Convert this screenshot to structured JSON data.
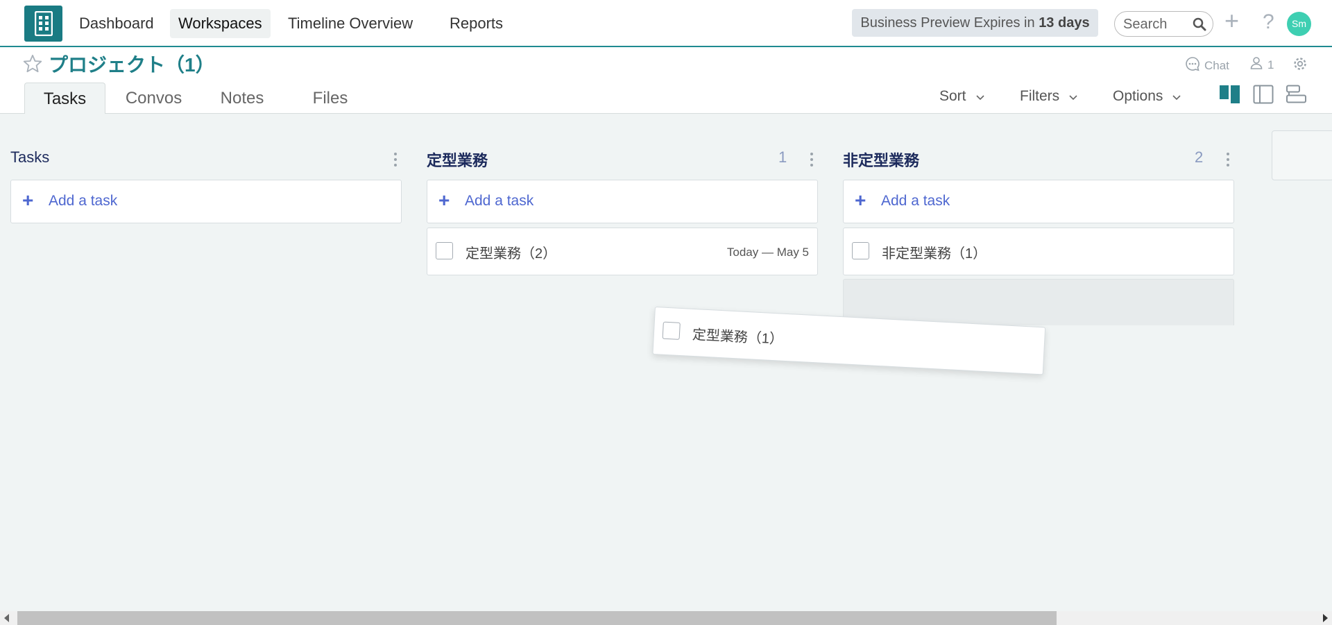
{
  "nav": {
    "items": [
      {
        "label": "Dashboard",
        "active": false
      },
      {
        "label": "Workspaces",
        "active": true
      },
      {
        "label": "Timeline Overview",
        "active": false
      },
      {
        "label": "Reports",
        "active": false
      }
    ],
    "promo_prefix": "Business Preview Expires in",
    "promo_days": "13 days",
    "search_placeholder": "Search",
    "avatar_initials": "Sm"
  },
  "project": {
    "title": "プロジェクト（1）",
    "chat_label": "Chat",
    "member_count": "1"
  },
  "tabs": [
    "Tasks",
    "Convos",
    "Notes",
    "Files"
  ],
  "active_tab": "Tasks",
  "toolbar": {
    "sort": "Sort",
    "filters": "Filters",
    "options": "Options"
  },
  "columns": [
    {
      "title": "Tasks",
      "count": "",
      "add_label": "Add a task",
      "tasks": []
    },
    {
      "title": "定型業務",
      "count": "1",
      "add_label": "Add a task",
      "tasks": [
        {
          "title": "定型業務（2）",
          "due": "Today — May 5"
        }
      ]
    },
    {
      "title": "非定型業務",
      "count": "2",
      "add_label": "Add a task",
      "tasks": [
        {
          "title": "非定型業務（1）",
          "due": ""
        }
      ]
    }
  ],
  "dragging_task": {
    "title": "定型業務（1）"
  },
  "colors": {
    "brand": "#1a7b83",
    "accent": "#4e67d0",
    "column_title": "#1c2a5c",
    "avatar": "#3ecfb2"
  }
}
